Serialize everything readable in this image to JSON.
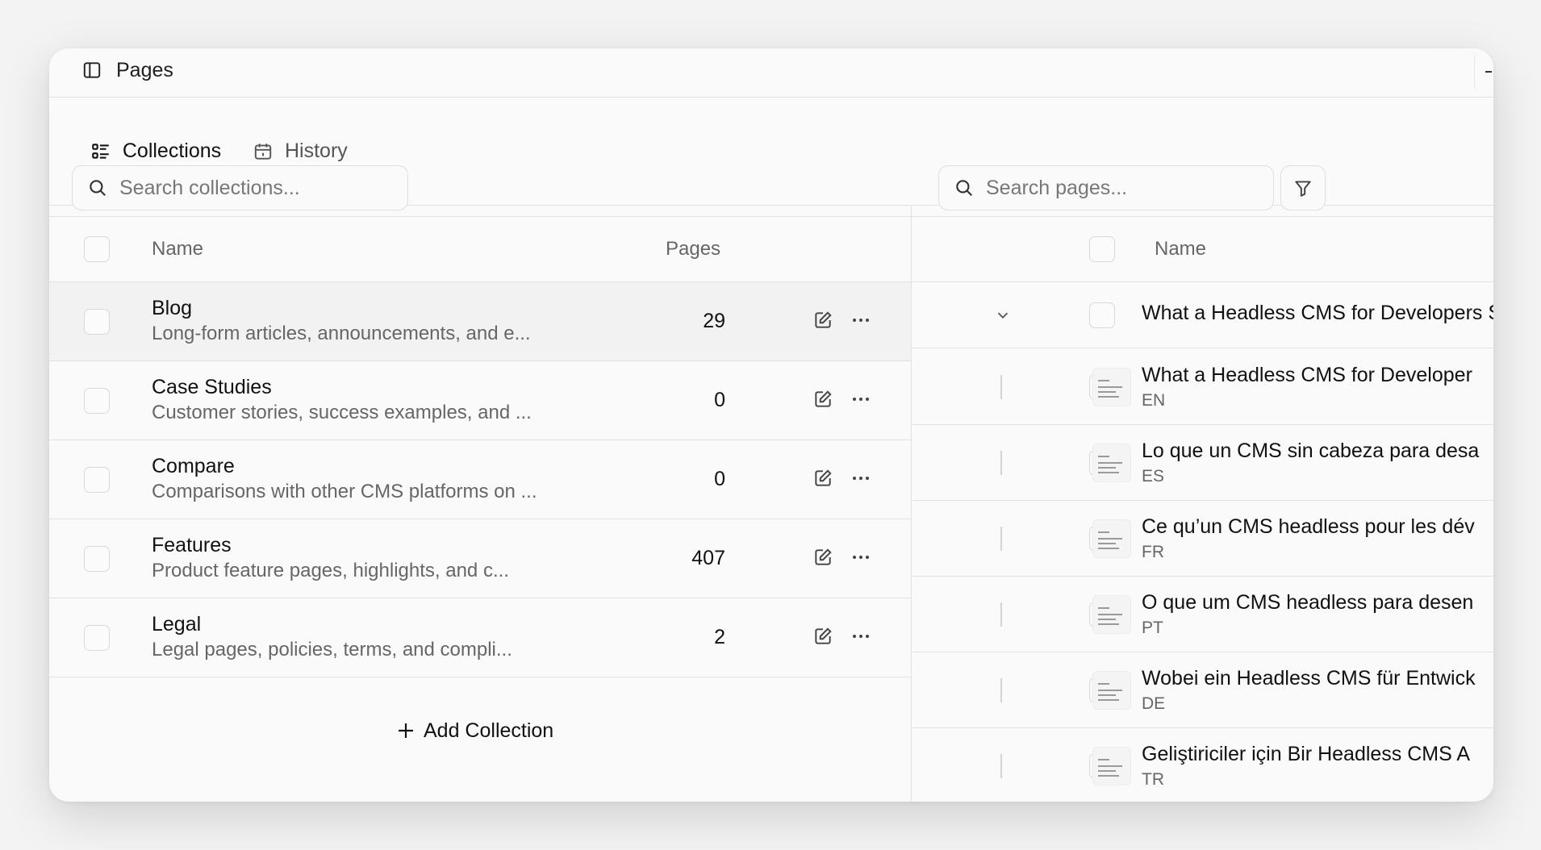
{
  "window": {
    "title": "Pages"
  },
  "tabs": [
    {
      "label": "Collections",
      "icon": "list-icon",
      "active": true
    },
    {
      "label": "History",
      "icon": "calendar-icon",
      "active": false
    }
  ],
  "collections": {
    "search_placeholder": "Search collections...",
    "headers": {
      "name": "Name",
      "pages": "Pages"
    },
    "rows": [
      {
        "name": "Blog",
        "description": "Long-form articles, announcements, and e...",
        "pages": "29"
      },
      {
        "name": "Case Studies",
        "description": "Customer stories, success examples, and ...",
        "pages": "0"
      },
      {
        "name": "Compare",
        "description": "Comparisons with other CMS platforms on ...",
        "pages": "0"
      },
      {
        "name": "Features",
        "description": "Product feature pages, highlights, and c...",
        "pages": "407"
      },
      {
        "name": "Legal",
        "description": "Legal pages, policies, terms, and compli...",
        "pages": "2"
      }
    ],
    "add_label": "Add Collection"
  },
  "pages": {
    "search_placeholder": "Search pages...",
    "headers": {
      "name": "Name"
    },
    "parent": {
      "title": "What a Headless CMS for Developers Sho"
    },
    "children": [
      {
        "title": "What a Headless CMS for Developer",
        "lang": "EN"
      },
      {
        "title": "Lo que un CMS sin cabeza para desa",
        "lang": "ES"
      },
      {
        "title": "Ce qu’un CMS headless pour les dév",
        "lang": "FR"
      },
      {
        "title": "O que um CMS headless para desen",
        "lang": "PT"
      },
      {
        "title": "Wobei ein Headless CMS für Entwick",
        "lang": "DE"
      },
      {
        "title": "Geliştiriciler için Bir Headless CMS A",
        "lang": "TR"
      }
    ]
  }
}
